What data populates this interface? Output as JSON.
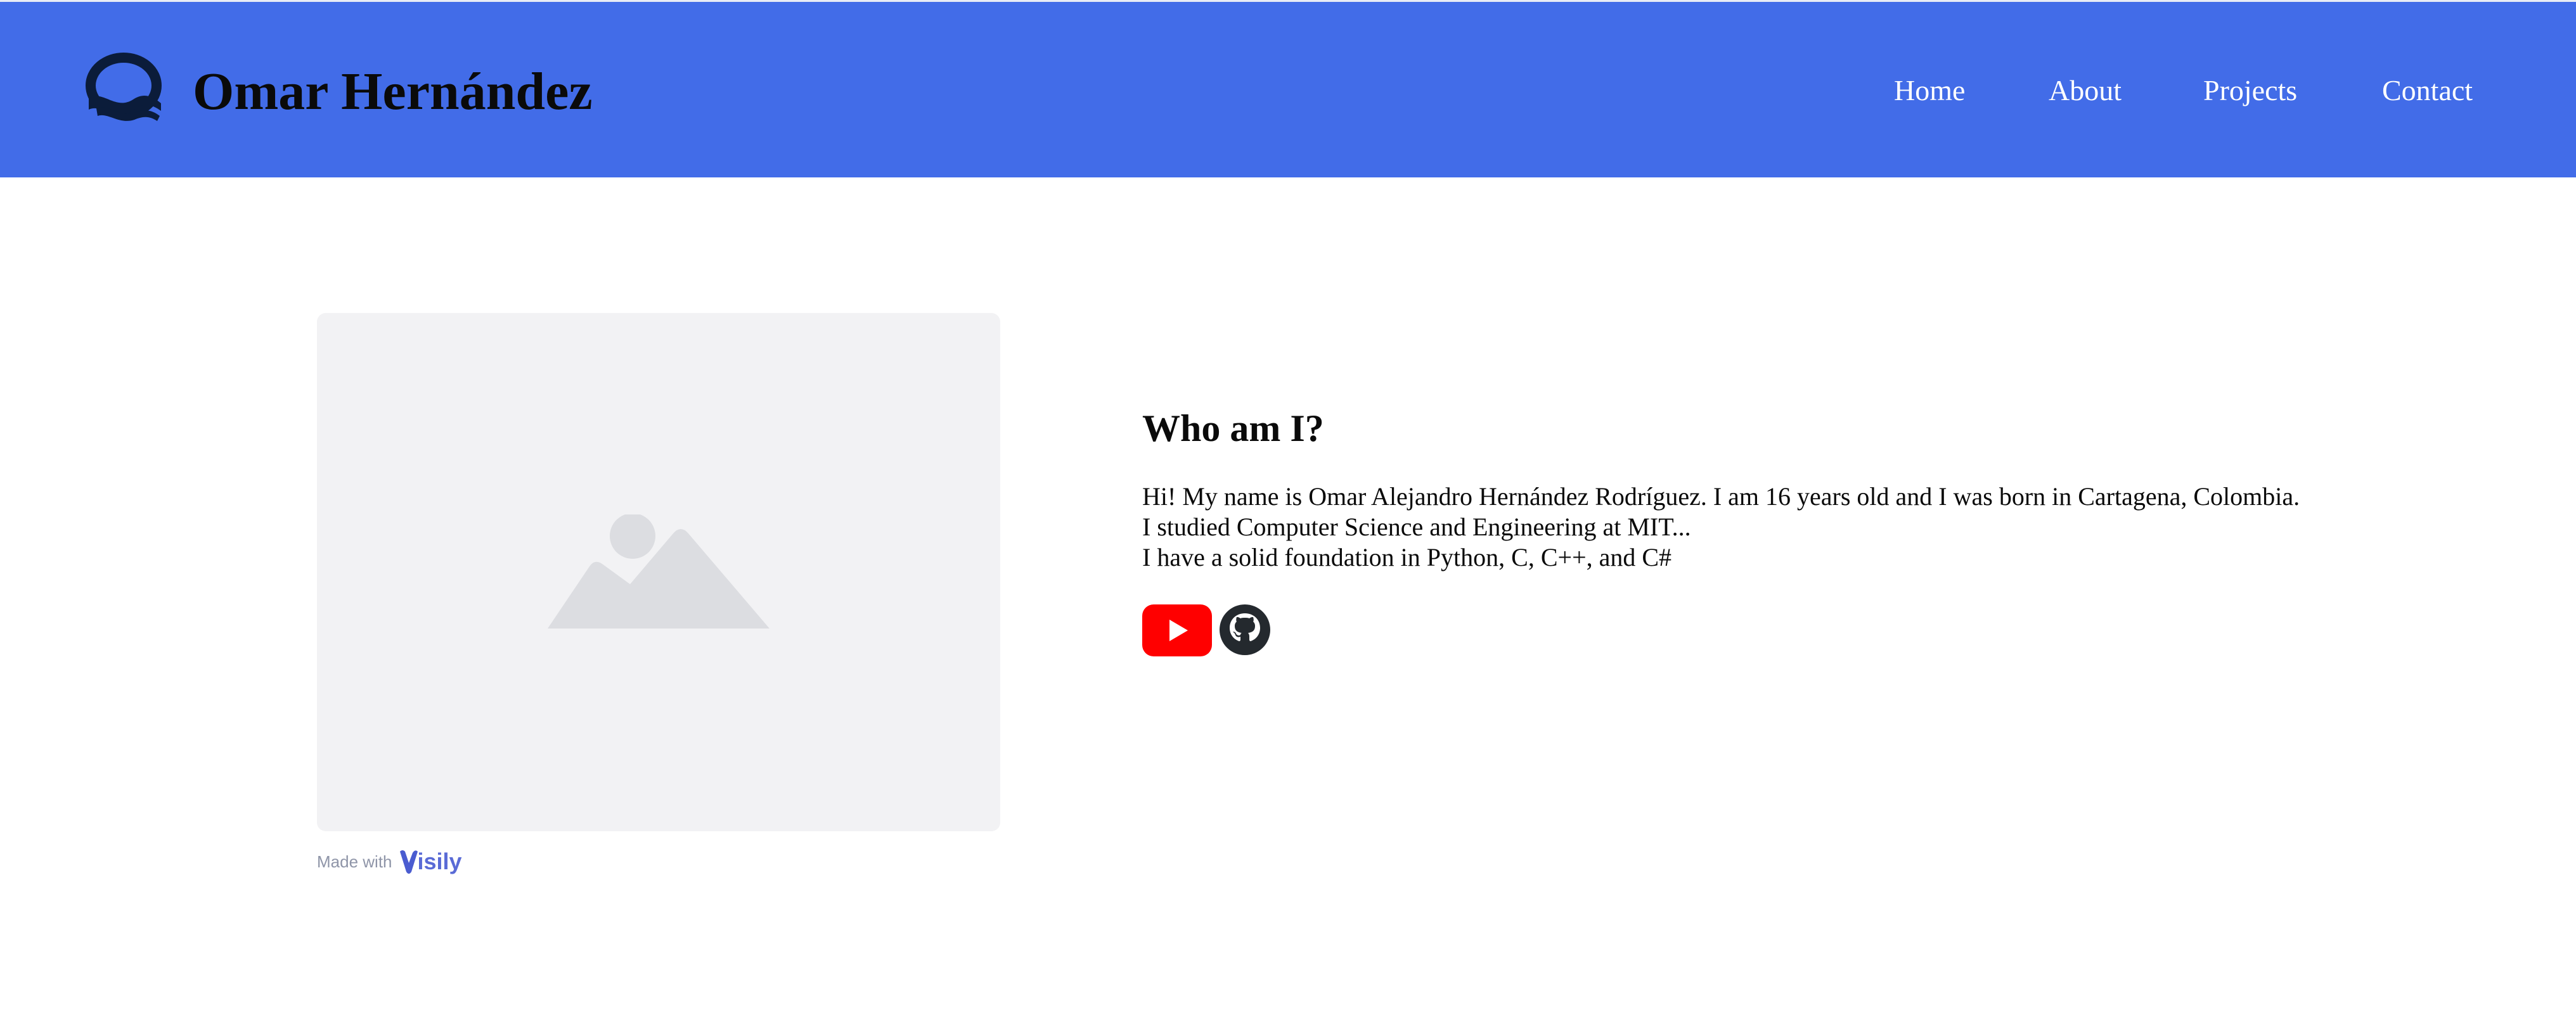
{
  "header": {
    "brand_name": "Omar Hernández",
    "background_color": "#426ce8",
    "logo_icon": "ornate-letter-o-logo",
    "nav": [
      {
        "label": "Home"
      },
      {
        "label": "About"
      },
      {
        "label": "Projects"
      },
      {
        "label": "Contact"
      }
    ]
  },
  "main": {
    "image_placeholder_icon": "image-placeholder-icon",
    "made_with": {
      "prefix": "Made with",
      "brand": "isily"
    },
    "about": {
      "title": "Who am I?",
      "lines": [
        "Hi! My name is Omar Alejandro Hernández Rodríguez. I am 16 years old and I was born in Cartagena, Colombia.",
        "I studied Computer Science and Engineering at MIT...",
        "I have a solid foundation in Python, C, C++, and C#"
      ]
    },
    "social": [
      {
        "icon": "youtube-icon",
        "color": "#ff0000"
      },
      {
        "icon": "github-icon",
        "color": "#24292e"
      }
    ]
  }
}
